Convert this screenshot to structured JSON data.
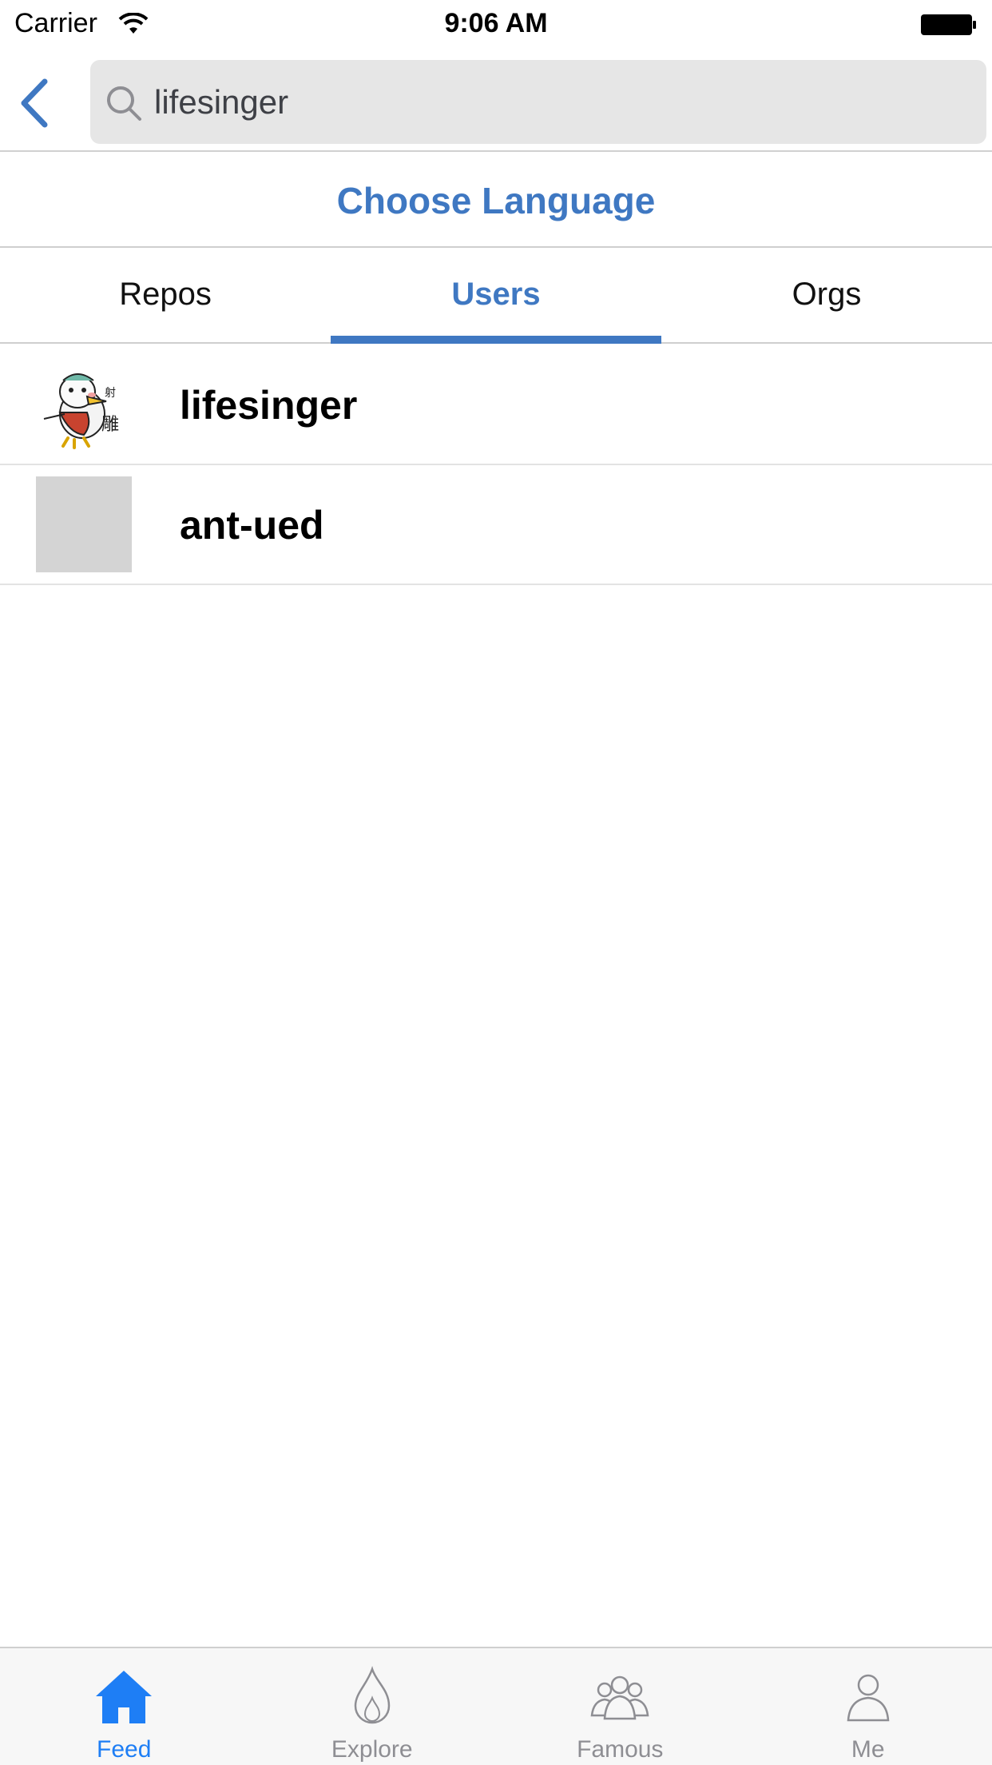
{
  "status_bar": {
    "carrier": "Carrier",
    "time": "9:06 AM"
  },
  "search": {
    "value": "lifesinger"
  },
  "choose_language": "Choose Language",
  "tabs": [
    {
      "label": "Repos",
      "active": false
    },
    {
      "label": "Users",
      "active": true
    },
    {
      "label": "Orgs",
      "active": false
    }
  ],
  "results": [
    {
      "name": "lifesinger",
      "avatar": "cartoon-bird-avatar"
    },
    {
      "name": "ant-ued",
      "avatar": "placeholder-avatar"
    }
  ],
  "tabbar": [
    {
      "label": "Feed",
      "icon": "home-icon",
      "active": true
    },
    {
      "label": "Explore",
      "icon": "flame-icon",
      "active": false
    },
    {
      "label": "Famous",
      "icon": "group-icon",
      "active": false
    },
    {
      "label": "Me",
      "icon": "person-icon",
      "active": false
    }
  ],
  "colors": {
    "accent": "#3f78c2",
    "tab_active": "#1e7ef5",
    "tab_inactive": "#8e8e93"
  }
}
